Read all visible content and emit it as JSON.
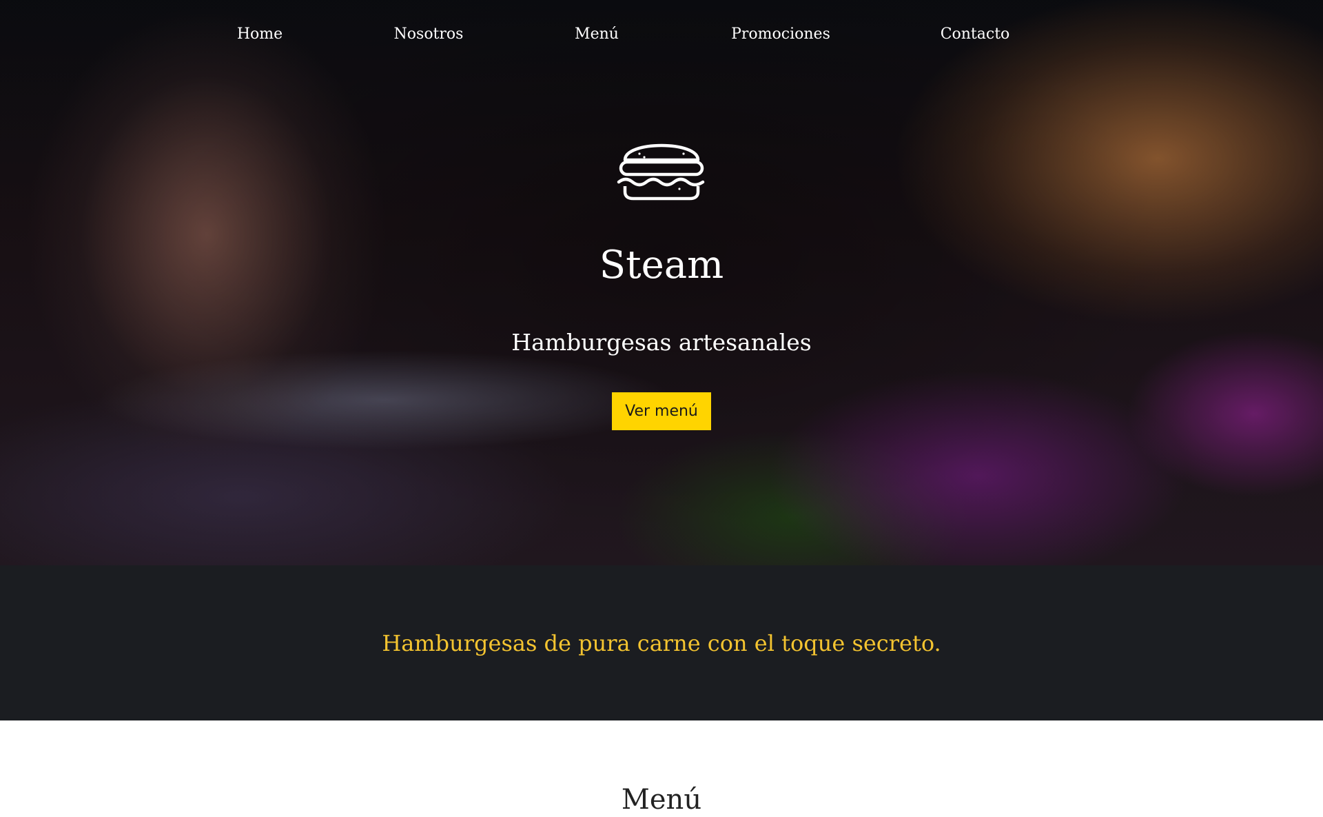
{
  "nav": {
    "items": [
      {
        "label": "Home"
      },
      {
        "label": "Nosotros"
      },
      {
        "label": "Menú"
      },
      {
        "label": "Promociones"
      },
      {
        "label": "Contacto"
      }
    ]
  },
  "hero": {
    "logo_icon": "burger-icon",
    "brand": "Steam",
    "tagline": "Hamburgesas artesanales",
    "cta_label": "Ver menú"
  },
  "band": {
    "text": "Hamburgesas de pura carne con el toque secreto."
  },
  "menu": {
    "title": "Menú"
  },
  "colors": {
    "accent": "#ffd400",
    "band_bg": "#1b1d21",
    "band_text": "#f4c430"
  }
}
